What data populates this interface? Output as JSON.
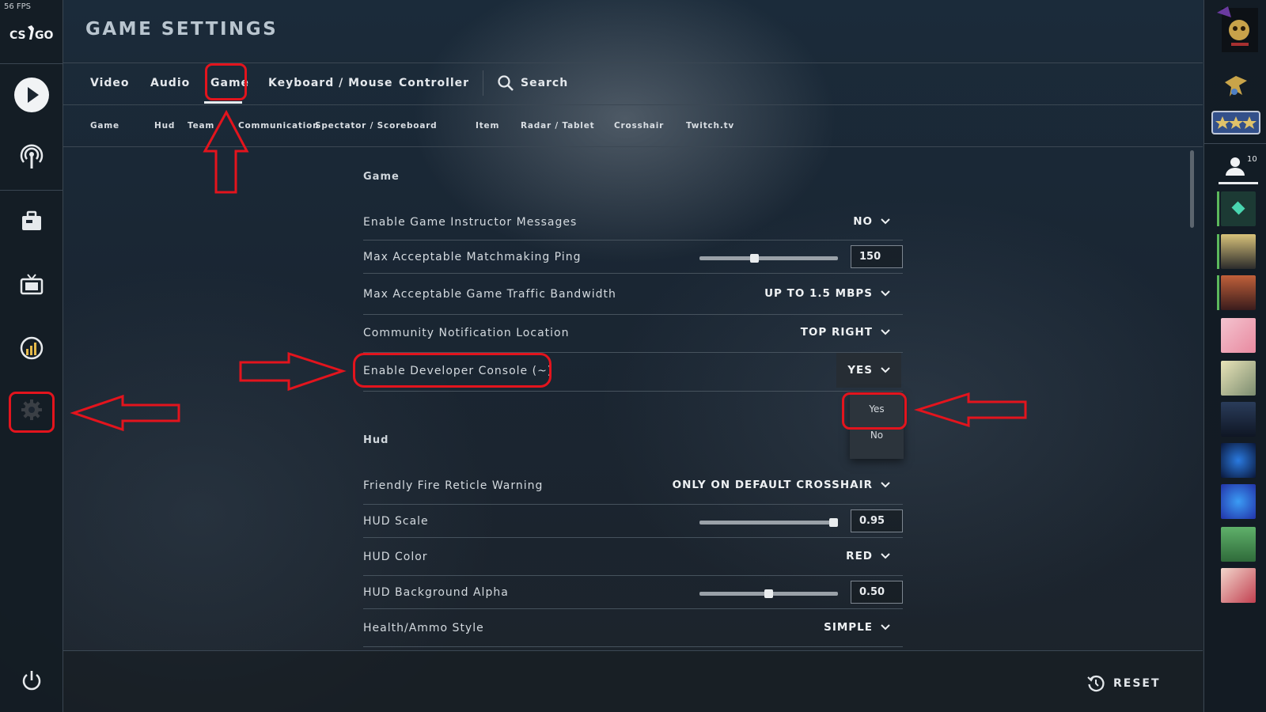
{
  "fps": "56 FPS",
  "logo": "CS:GO",
  "header": {
    "title": "GAME SETTINGS"
  },
  "tabs": [
    "Video",
    "Audio",
    "Game",
    "Keyboard / Mouse",
    "Controller"
  ],
  "search_label": "Search",
  "subtabs": [
    "Game",
    "Hud",
    "Team",
    "Communication",
    "Spectator / Scoreboard",
    "Item",
    "Radar / Tablet",
    "Crosshair",
    "Twitch.tv"
  ],
  "sections": {
    "game": {
      "title": "Game",
      "rows": [
        {
          "label": "Enable Game Instructor Messages",
          "value": "NO"
        },
        {
          "label": "Max Acceptable Matchmaking Ping",
          "value": "150",
          "slider_fraction": 0.4
        },
        {
          "label": "Max Acceptable Game Traffic Bandwidth",
          "value": "UP TO 1.5 MBPS"
        },
        {
          "label": "Community Notification Location",
          "value": "TOP RIGHT"
        },
        {
          "label": "Enable Developer Console (~)",
          "value": "YES"
        }
      ]
    },
    "hud": {
      "title": "Hud",
      "rows": [
        {
          "label": "Friendly Fire Reticle Warning",
          "value": "ONLY ON DEFAULT CROSSHAIR"
        },
        {
          "label": "HUD Scale",
          "value": "0.95",
          "slider_fraction": 0.95
        },
        {
          "label": "HUD Color",
          "value": "RED"
        },
        {
          "label": "HUD Background Alpha",
          "value": "0.50",
          "slider_fraction": 0.5
        },
        {
          "label": "Health/Ammo Style",
          "value": "SIMPLE"
        }
      ]
    }
  },
  "dropdown_options": [
    "Yes",
    "No"
  ],
  "reset_label": "RESET",
  "friends_count": "10",
  "colors": {
    "annotation": "#e3141d",
    "online": "#5cb85c"
  }
}
